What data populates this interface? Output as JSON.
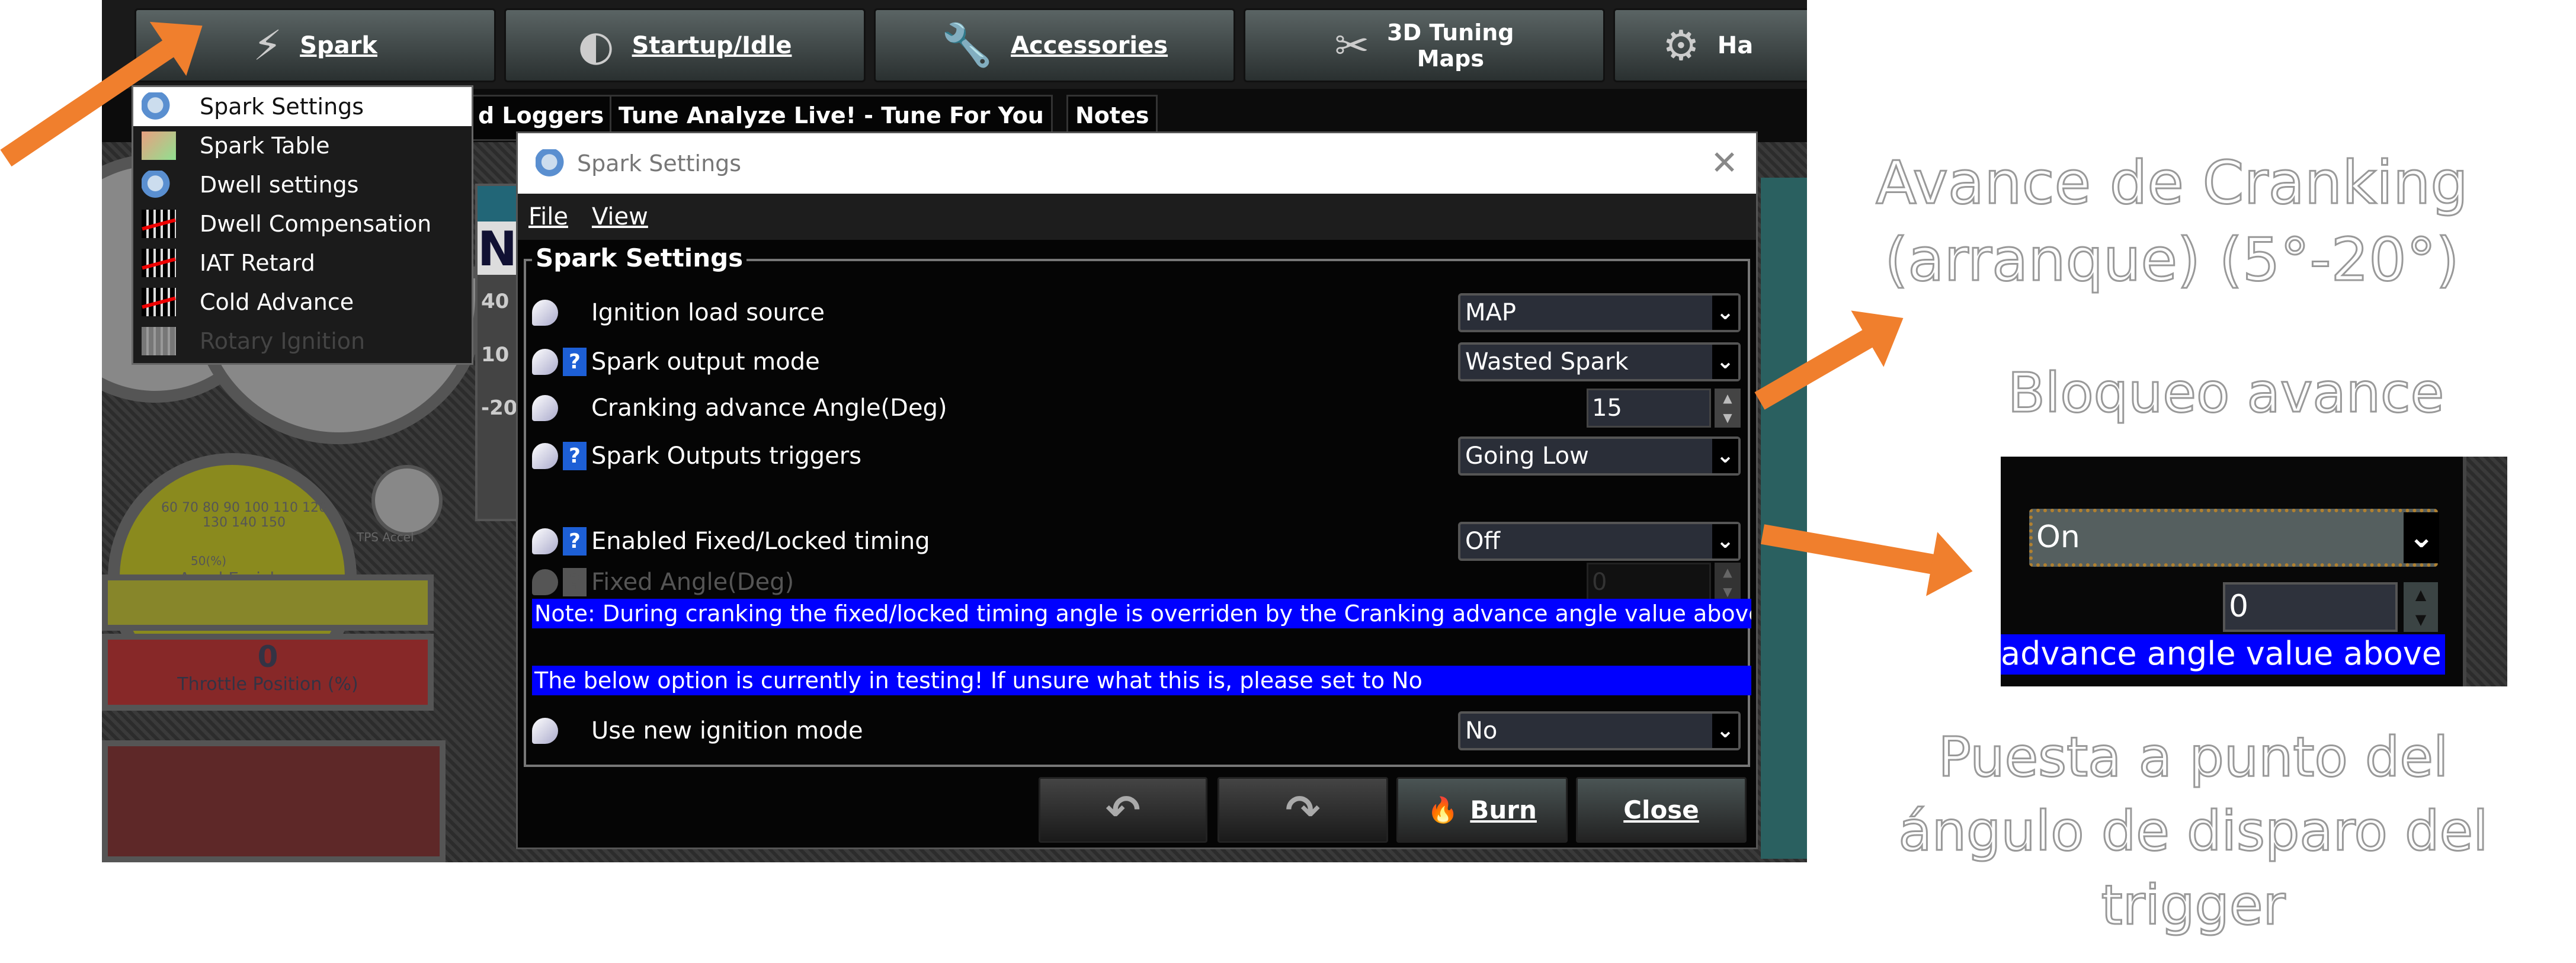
{
  "toolbar": {
    "buttons": [
      {
        "label": "Spark",
        "icon": "spark-plug-icon"
      },
      {
        "label": "Startup/Idle",
        "icon": "gauge-icon"
      },
      {
        "label": "Accessories",
        "icon": "wrench-icon"
      },
      {
        "label": "3D Tuning Maps",
        "line1": "3D Tuning",
        "line2": "Maps",
        "icon": "tools-icon"
      },
      {
        "label": "Ha",
        "icon": "piston-icon"
      }
    ]
  },
  "tabs": [
    "d Loggers",
    "Tune Analyze Live! - Tune For You",
    "Notes"
  ],
  "menu": {
    "items": [
      {
        "label": "Spark Settings",
        "selected": true
      },
      {
        "label": "Spark Table"
      },
      {
        "label": "Dwell settings"
      },
      {
        "label": "Dwell Compensation"
      },
      {
        "label": "IAT Retard"
      },
      {
        "label": "Cold Advance"
      },
      {
        "label": "Rotary Ignition",
        "disabled": true
      }
    ]
  },
  "background": {
    "accel_gauge_label": "Accel Enrich",
    "accel_gauge_unit": "50(%)",
    "accel_ticks": [
      "60",
      "70",
      "80",
      "90",
      "100",
      "110",
      "120",
      "130",
      "140",
      "150"
    ],
    "tps_label": "TPS Accel",
    "throttle_value": "0",
    "throttle_label": "Throttle Position (%)",
    "side_ticks": [
      "40",
      "10",
      "-20"
    ]
  },
  "dialog": {
    "title": "Spark Settings",
    "menu": [
      "File",
      "View"
    ],
    "group_title": "Spark Settings",
    "rows": {
      "ignition_load": {
        "label": "Ignition load source",
        "value": "MAP"
      },
      "spark_output": {
        "label": "Spark output mode",
        "value": "Wasted Spark"
      },
      "cranking": {
        "label": "Cranking advance Angle(Deg)",
        "value": "15"
      },
      "triggers": {
        "label": "Spark Outputs triggers",
        "value": "Going Low"
      },
      "fixed_enabled": {
        "label": "Enabled Fixed/Locked timing",
        "value": "Off"
      },
      "fixed_angle": {
        "label": "Fixed Angle(Deg)",
        "value": "0"
      },
      "new_ignition": {
        "label": "Use new ignition mode",
        "value": "No"
      }
    },
    "note1": "Note: During cranking the fixed/locked timing angle is overriden by the Cranking advance angle value above",
    "note2": "The below option is currently in testing! If unsure what this is, please set to No",
    "buttons": {
      "burn": "Burn",
      "close": "Close"
    }
  },
  "annotations": {
    "cranking_title": "Avance de Cranking",
    "cranking_sub": "(arranque) (5°-20°)",
    "lock_title": "Bloqueo avance",
    "trigger_1": "Puesta a punto del",
    "trigger_2": "ángulo de disparo del",
    "trigger_3": "trigger"
  },
  "inset": {
    "dropdown_value": "On",
    "spinner_value": "0",
    "band_text": "advance angle value above"
  },
  "colors": {
    "arrow": "#f07f2d",
    "note_band": "#0000ff",
    "dialog_bg": "#050505"
  }
}
